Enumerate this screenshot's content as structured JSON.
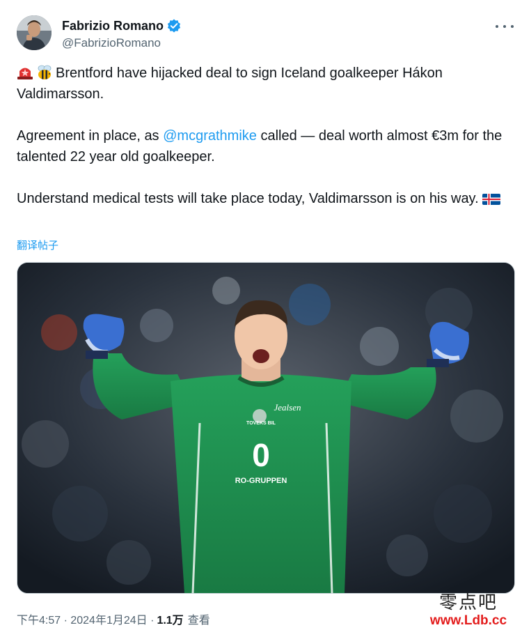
{
  "author": {
    "display_name": "Fabrizio Romano",
    "handle": "@FabrizioRomano",
    "verified": true,
    "avatar_icon": "avatar-photo"
  },
  "menu_icon": "more-icon",
  "tweet": {
    "paragraph_1": "Brentford have hijacked deal to sign Iceland goalkeeper Hákon Valdimarsson.",
    "paragraph_2_before": "Agreement in place, as ",
    "mention": "@mcgrathmike",
    "paragraph_2_after": " called — deal worth almost €3m for the talented 22 year old goalkeeper.",
    "paragraph_3": "Understand medical tests will take place today, Valdimarsson is on his way.",
    "leading_emojis": [
      "siren-emoji",
      "bee-emoji"
    ],
    "trailing_emoji": "iceland-flag-emoji"
  },
  "translate_label": "翻译帖子",
  "media": {
    "shirt_number": "0",
    "shirt_sponsor": "RO-GRUPPEN",
    "shirt_top_sponsor": "TOVEKS BIL",
    "shirt_chest_logo": "Jealsen"
  },
  "footer": {
    "timestamp": "下午4:57 · 2024年1月24日 · ",
    "views_count": "1.1万",
    "views_label": "查看"
  },
  "watermark": {
    "chinese": "零点吧",
    "url": "www.Ldb.cc"
  },
  "colors": {
    "link": "#1d9bf0",
    "secondary_text": "#536471",
    "jersey": "#1f8a4c",
    "watermark_url": "#e31c1c"
  }
}
